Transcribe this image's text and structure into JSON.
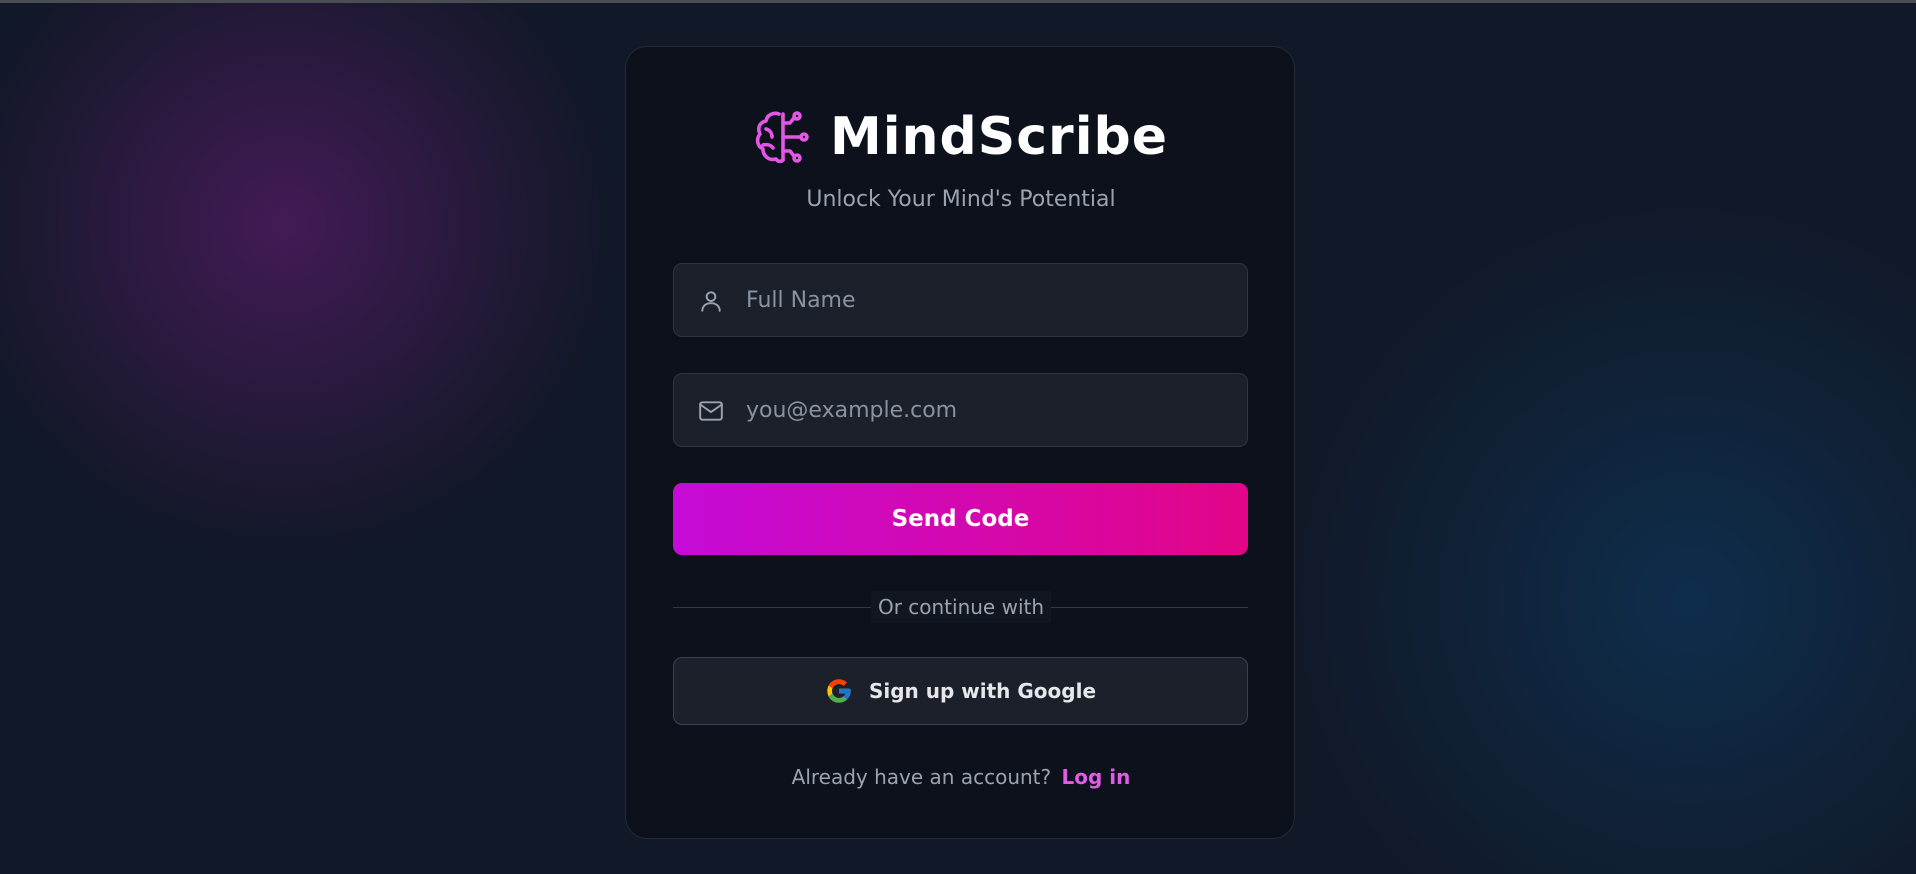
{
  "brand": {
    "name": "MindScribe",
    "tagline": "Unlock Your Mind's Potential",
    "icon": "brain-circuit-icon",
    "accent_color": "#e356e6"
  },
  "form": {
    "name_placeholder": "Full Name",
    "name_icon": "user-icon",
    "email_placeholder": "you@example.com",
    "email_icon": "mail-icon",
    "submit_label": "Send Code",
    "submit_gradient": [
      "#c50bd8",
      "#e20587"
    ]
  },
  "divider": {
    "label": "Or continue with"
  },
  "social": {
    "google_label": "Sign up with Google",
    "google_icon": "google-icon"
  },
  "footer": {
    "prompt": "Already have an account?",
    "login_label": "Log in",
    "login_color": "#e05ce6"
  }
}
